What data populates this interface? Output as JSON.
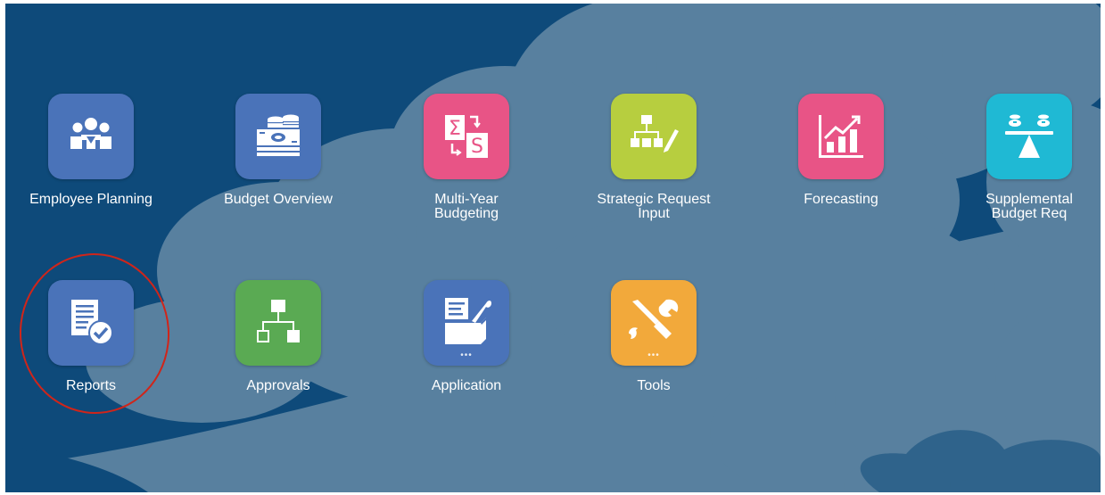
{
  "colors": {
    "background": "#0e4a7a",
    "cloud": "#58809f",
    "highlight_circle": "#d0251a"
  },
  "tiles": [
    {
      "label": "Employee Planning",
      "icon": "people-group-icon",
      "color": "#4a73b9"
    },
    {
      "label": "Budget Overview",
      "icon": "money-stack-icon",
      "color": "#4a73b9"
    },
    {
      "label": "Multi-Year\nBudgeting",
      "icon": "sigma-s-icon",
      "color": "#e85486"
    },
    {
      "label": "Strategic Request\nInput",
      "icon": "org-chart-pencil-icon",
      "color": "#b7ce3f"
    },
    {
      "label": "Forecasting",
      "icon": "bar-chart-trend-icon",
      "color": "#e85486"
    },
    {
      "label": "Supplemental\nBudget Req",
      "icon": "balance-scale-icon",
      "color": "#1fb9d4"
    },
    {
      "label": "Reports",
      "icon": "report-check-icon",
      "color": "#4a73b9"
    },
    {
      "label": "Approvals",
      "icon": "hierarchy-icon",
      "color": "#5aaa53"
    },
    {
      "label": "Application",
      "icon": "box-wrench-icon",
      "color": "#4a73b9",
      "overflow_dots": "•••"
    },
    {
      "label": "Tools",
      "icon": "wrench-screwdriver-icon",
      "color": "#f2a93b",
      "overflow_dots": "•••"
    }
  ]
}
